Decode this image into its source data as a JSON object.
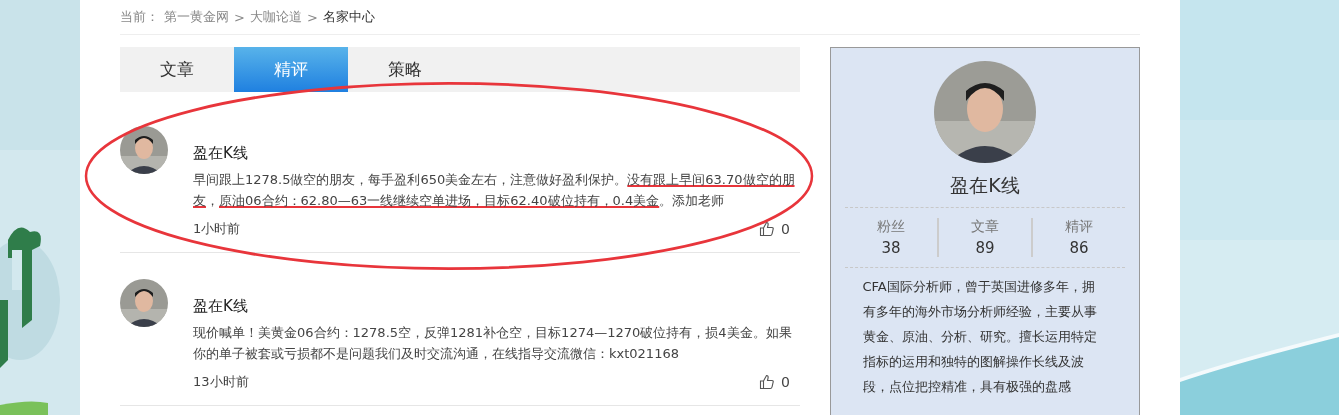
{
  "breadcrumb": {
    "prefix": "当前：",
    "items": [
      {
        "label": "第一黄金网",
        "current": false
      },
      {
        "label": "大咖论道",
        "current": false
      },
      {
        "label": "名家中心",
        "current": true
      }
    ],
    "separator": ">"
  },
  "tabs": [
    {
      "label": "文章",
      "selected": false
    },
    {
      "label": "精评",
      "selected": true
    },
    {
      "label": "策略",
      "selected": false
    }
  ],
  "posts": [
    {
      "author": "盈在K线",
      "highlighted": true,
      "segments": [
        {
          "text": "早间跟上1278.5做空的朋友，每手盈利650美金左右，注意做好盈利保护。",
          "underlined": false
        },
        {
          "text": "没有跟上早间63.70做空的朋友",
          "underlined": true
        },
        {
          "text": "，",
          "underlined": false
        },
        {
          "text": "原油06合约：62.80—63一线继续空单进场，目标62.40破位持有，0.4美金",
          "underlined": true
        },
        {
          "text": "。添加老师",
          "underlined": false
        }
      ],
      "time": "1小时前",
      "likes": "0"
    },
    {
      "author": "盈在K线",
      "highlighted": false,
      "segments": [
        {
          "text": "现价喊单！美黄金06合约：1278.5空，反弹1281补仓空，目标1274—1270破位持有，损4美金。如果你的单子被套或亏损都不是问题我们及时交流沟通，在线指导交流微信：kxt021168",
          "underlined": false
        }
      ],
      "time": "13小时前",
      "likes": "0"
    }
  ],
  "profile": {
    "name": "盈在K线",
    "stats": [
      {
        "label": "粉丝",
        "value": "38"
      },
      {
        "label": "文章",
        "value": "89"
      },
      {
        "label": "精评",
        "value": "86"
      }
    ],
    "bio": "CFA国际分析师，曾于英国进修多年，拥有多年的海外市场分析师经验，主要从事黄金、原油、分析、研究。擅长运用特定指标的运用和独特的图解操作长线及波段，点位把控精准，具有极强的盘感"
  }
}
